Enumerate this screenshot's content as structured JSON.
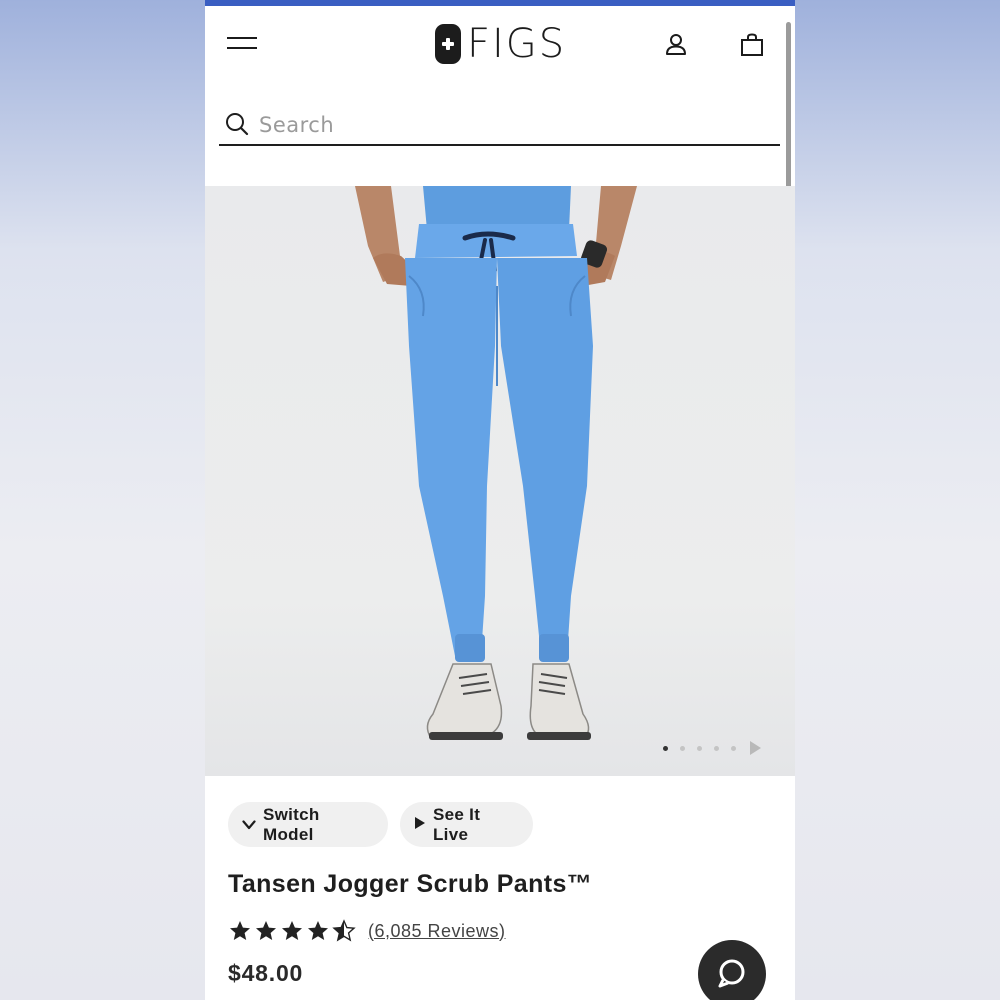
{
  "header": {
    "logo_text": "FIGS"
  },
  "search": {
    "placeholder": "Search"
  },
  "hero": {
    "image_alt": "Model wearing blue jogger scrub pants",
    "carousel_count": 5,
    "active_index": 0
  },
  "actions": {
    "switch_model_label": "Switch Model",
    "see_it_live_label": "See It Live"
  },
  "product": {
    "title": "Tansen Jogger Scrub Pants™",
    "rating": 4.5,
    "reviews_text": "(6,085 Reviews)",
    "price": "$48.00"
  },
  "colors": {
    "accent_bar": "#3a5ec2",
    "pants": "#64a3e6"
  },
  "icons": {
    "menu": "hamburger-icon",
    "account": "user-icon",
    "cart": "bag-icon",
    "search": "search-icon",
    "chat": "chat-icon"
  }
}
